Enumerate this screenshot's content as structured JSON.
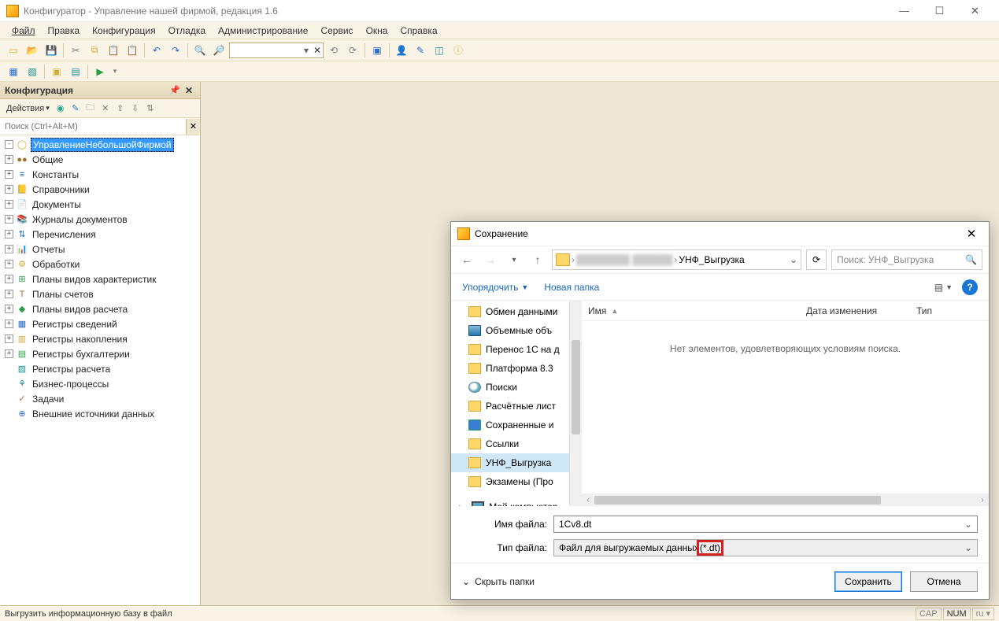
{
  "window": {
    "title": "Конфигуратор - Управление нашей фирмой, редакция 1.6"
  },
  "menu": {
    "file": "Файл",
    "edit": "Правка",
    "config": "Конфигурация",
    "debug": "Отладка",
    "admin": "Администрирование",
    "service": "Сервис",
    "windows": "Окна",
    "help": "Справка"
  },
  "panel": {
    "title": "Конфигурация",
    "actions_label": "Действия",
    "search_placeholder": "Поиск (Ctrl+Alt+M)"
  },
  "tree": {
    "root": "УправлениеНебольшойФирмой",
    "items": [
      {
        "label": "Общие",
        "icon": "●●",
        "cls": "g-brown"
      },
      {
        "label": "Константы",
        "icon": "≡",
        "cls": "g-blue"
      },
      {
        "label": "Справочники",
        "icon": "📒",
        "cls": "g-yellow"
      },
      {
        "label": "Документы",
        "icon": "📄",
        "cls": "g-gray"
      },
      {
        "label": "Журналы документов",
        "icon": "📚",
        "cls": "g-brown"
      },
      {
        "label": "Перечисления",
        "icon": "⇅",
        "cls": "g-blue"
      },
      {
        "label": "Отчеты",
        "icon": "📊",
        "cls": "g-teal"
      },
      {
        "label": "Обработки",
        "icon": "⚙",
        "cls": "g-yellow"
      },
      {
        "label": "Планы видов характеристик",
        "icon": "⊞",
        "cls": "g-green"
      },
      {
        "label": "Планы счетов",
        "icon": "Т",
        "cls": "g-brown"
      },
      {
        "label": "Планы видов расчета",
        "icon": "◆",
        "cls": "g-green"
      },
      {
        "label": "Регистры сведений",
        "icon": "▦",
        "cls": "g-blue"
      },
      {
        "label": "Регистры накопления",
        "icon": "▥",
        "cls": "g-yellow"
      },
      {
        "label": "Регистры бухгалтерии",
        "icon": "▤",
        "cls": "g-green"
      },
      {
        "label": "Регистры расчета",
        "icon": "▧",
        "cls": "g-teal"
      },
      {
        "label": "Бизнес-процессы",
        "icon": "⚘",
        "cls": "g-teal"
      },
      {
        "label": "Задачи",
        "icon": "✓",
        "cls": "g-brown"
      },
      {
        "label": "Внешние источники данных",
        "icon": "⊕",
        "cls": "g-blue"
      }
    ]
  },
  "statusbar": {
    "text": "Выгрузить информационную базу в файл",
    "cap": "CAP",
    "num": "NUM",
    "lang": "ru"
  },
  "dialog": {
    "title": "Сохранение",
    "breadcrumb_current": "УНФ_Выгрузка",
    "search_placeholder": "Поиск: УНФ_Выгрузка",
    "organize": "Упорядочить",
    "new_folder": "Новая папка",
    "columns": {
      "name": "Имя",
      "date": "Дата изменения",
      "type": "Тип"
    },
    "empty_text": "Нет элементов, удовлетворяющих условиям поиска.",
    "tree_items": [
      {
        "label": "Обмен данными",
        "kind": "folder"
      },
      {
        "label": "Объемные объ",
        "kind": "disk"
      },
      {
        "label": "Перенос 1С на д",
        "kind": "folder"
      },
      {
        "label": "Платформа 8.3",
        "kind": "folder"
      },
      {
        "label": "Поиски",
        "kind": "search"
      },
      {
        "label": "Расчётные лист",
        "kind": "folder"
      },
      {
        "label": "Сохраненные и",
        "kind": "comp"
      },
      {
        "label": "Ссылки",
        "kind": "folder"
      },
      {
        "label": "УНФ_Выгрузка",
        "kind": "folder",
        "selected": true
      },
      {
        "label": "Экзамены (Про",
        "kind": "folder"
      }
    ],
    "my_computer": "Мой компьютер",
    "filename_label": "Имя файла:",
    "filename_value": "1Cv8.dt",
    "filetype_label": "Тип файла:",
    "filetype_prefix": "Файл для выгружаемых данных ",
    "filetype_ext": "(*.dt)",
    "hide_folders": "Скрыть папки",
    "save": "Сохранить",
    "cancel": "Отмена"
  }
}
